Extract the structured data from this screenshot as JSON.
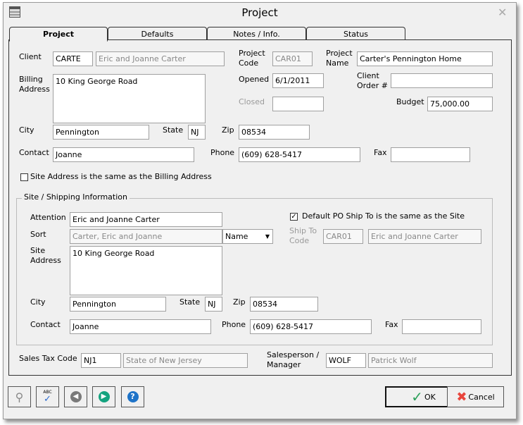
{
  "window": {
    "title": "Project",
    "close_icon": "close-icon",
    "app_icon": "form-icon"
  },
  "tabs": [
    {
      "label": "Project",
      "active": true
    },
    {
      "label": "Defaults"
    },
    {
      "label": "Notes / Info."
    },
    {
      "label": "Status"
    }
  ],
  "form": {
    "client_label": "Client",
    "client_code": "CARTE",
    "client_name": "Eric and Joanne Carter",
    "project_code_label": "Project Code",
    "project_code": "CAR01",
    "project_name_label": "Project Name",
    "project_name": "Carter's Pennington Home",
    "billing_address_label": "Billing Address",
    "billing_address": "10 King George Road",
    "opened_label": "Opened",
    "opened": "6/1/2011",
    "client_order_label": "Client Order #",
    "client_order": "",
    "closed_label": "Closed",
    "closed": "",
    "budget_label": "Budget",
    "budget": "75,000.00",
    "city_label": "City",
    "city": "Pennington",
    "state_label": "State",
    "state": "NJ",
    "zip_label": "Zip",
    "zip": "08534",
    "contact_label": "Contact",
    "contact": "Joanne",
    "phone_label": "Phone",
    "phone": "(609) 628-5417",
    "fax_label": "Fax",
    "fax": "",
    "site_same_label": "Site Address is the same as the Billing Address",
    "site_same_checked": false
  },
  "site": {
    "legend": "Site / Shipping Information",
    "attention_label": "Attention",
    "attention": "Eric and Joanne Carter",
    "sort_label": "Sort",
    "sort": "Carter, Eric and Joanne",
    "sort_by": "Name",
    "site_address_label": "Site Address",
    "site_address": "10 King George Road",
    "po_same_label": "Default PO Ship To is the same as the Site",
    "po_same_checked": true,
    "ship_to_label": "Ship To Code",
    "ship_to_code": "CAR01",
    "ship_to_name": "Eric and Joanne Carter",
    "city_label": "City",
    "city": "Pennington",
    "state_label": "State",
    "state": "NJ",
    "zip_label": "Zip",
    "zip": "08534",
    "contact_label": "Contact",
    "contact": "Joanne",
    "phone_label": "Phone",
    "phone": "(609) 628-5417",
    "fax_label": "Fax",
    "fax": ""
  },
  "footer": {
    "sales_tax_label": "Sales Tax Code",
    "sales_tax_code": "NJ1",
    "sales_tax_name": "State of New Jersey",
    "salesperson_label": "Salesperson / Manager",
    "salesperson_code": "WOLF",
    "salesperson_name": "Patrick Wolf"
  },
  "buttons": {
    "ok": "OK",
    "cancel": "Cancel",
    "spell": "ABC"
  },
  "colors": {
    "ok_check": "#2ca05a",
    "cancel_x": "#e8453c",
    "help": "#1e73c8",
    "next": "#14a37f",
    "prev": "#7a7a7a"
  }
}
